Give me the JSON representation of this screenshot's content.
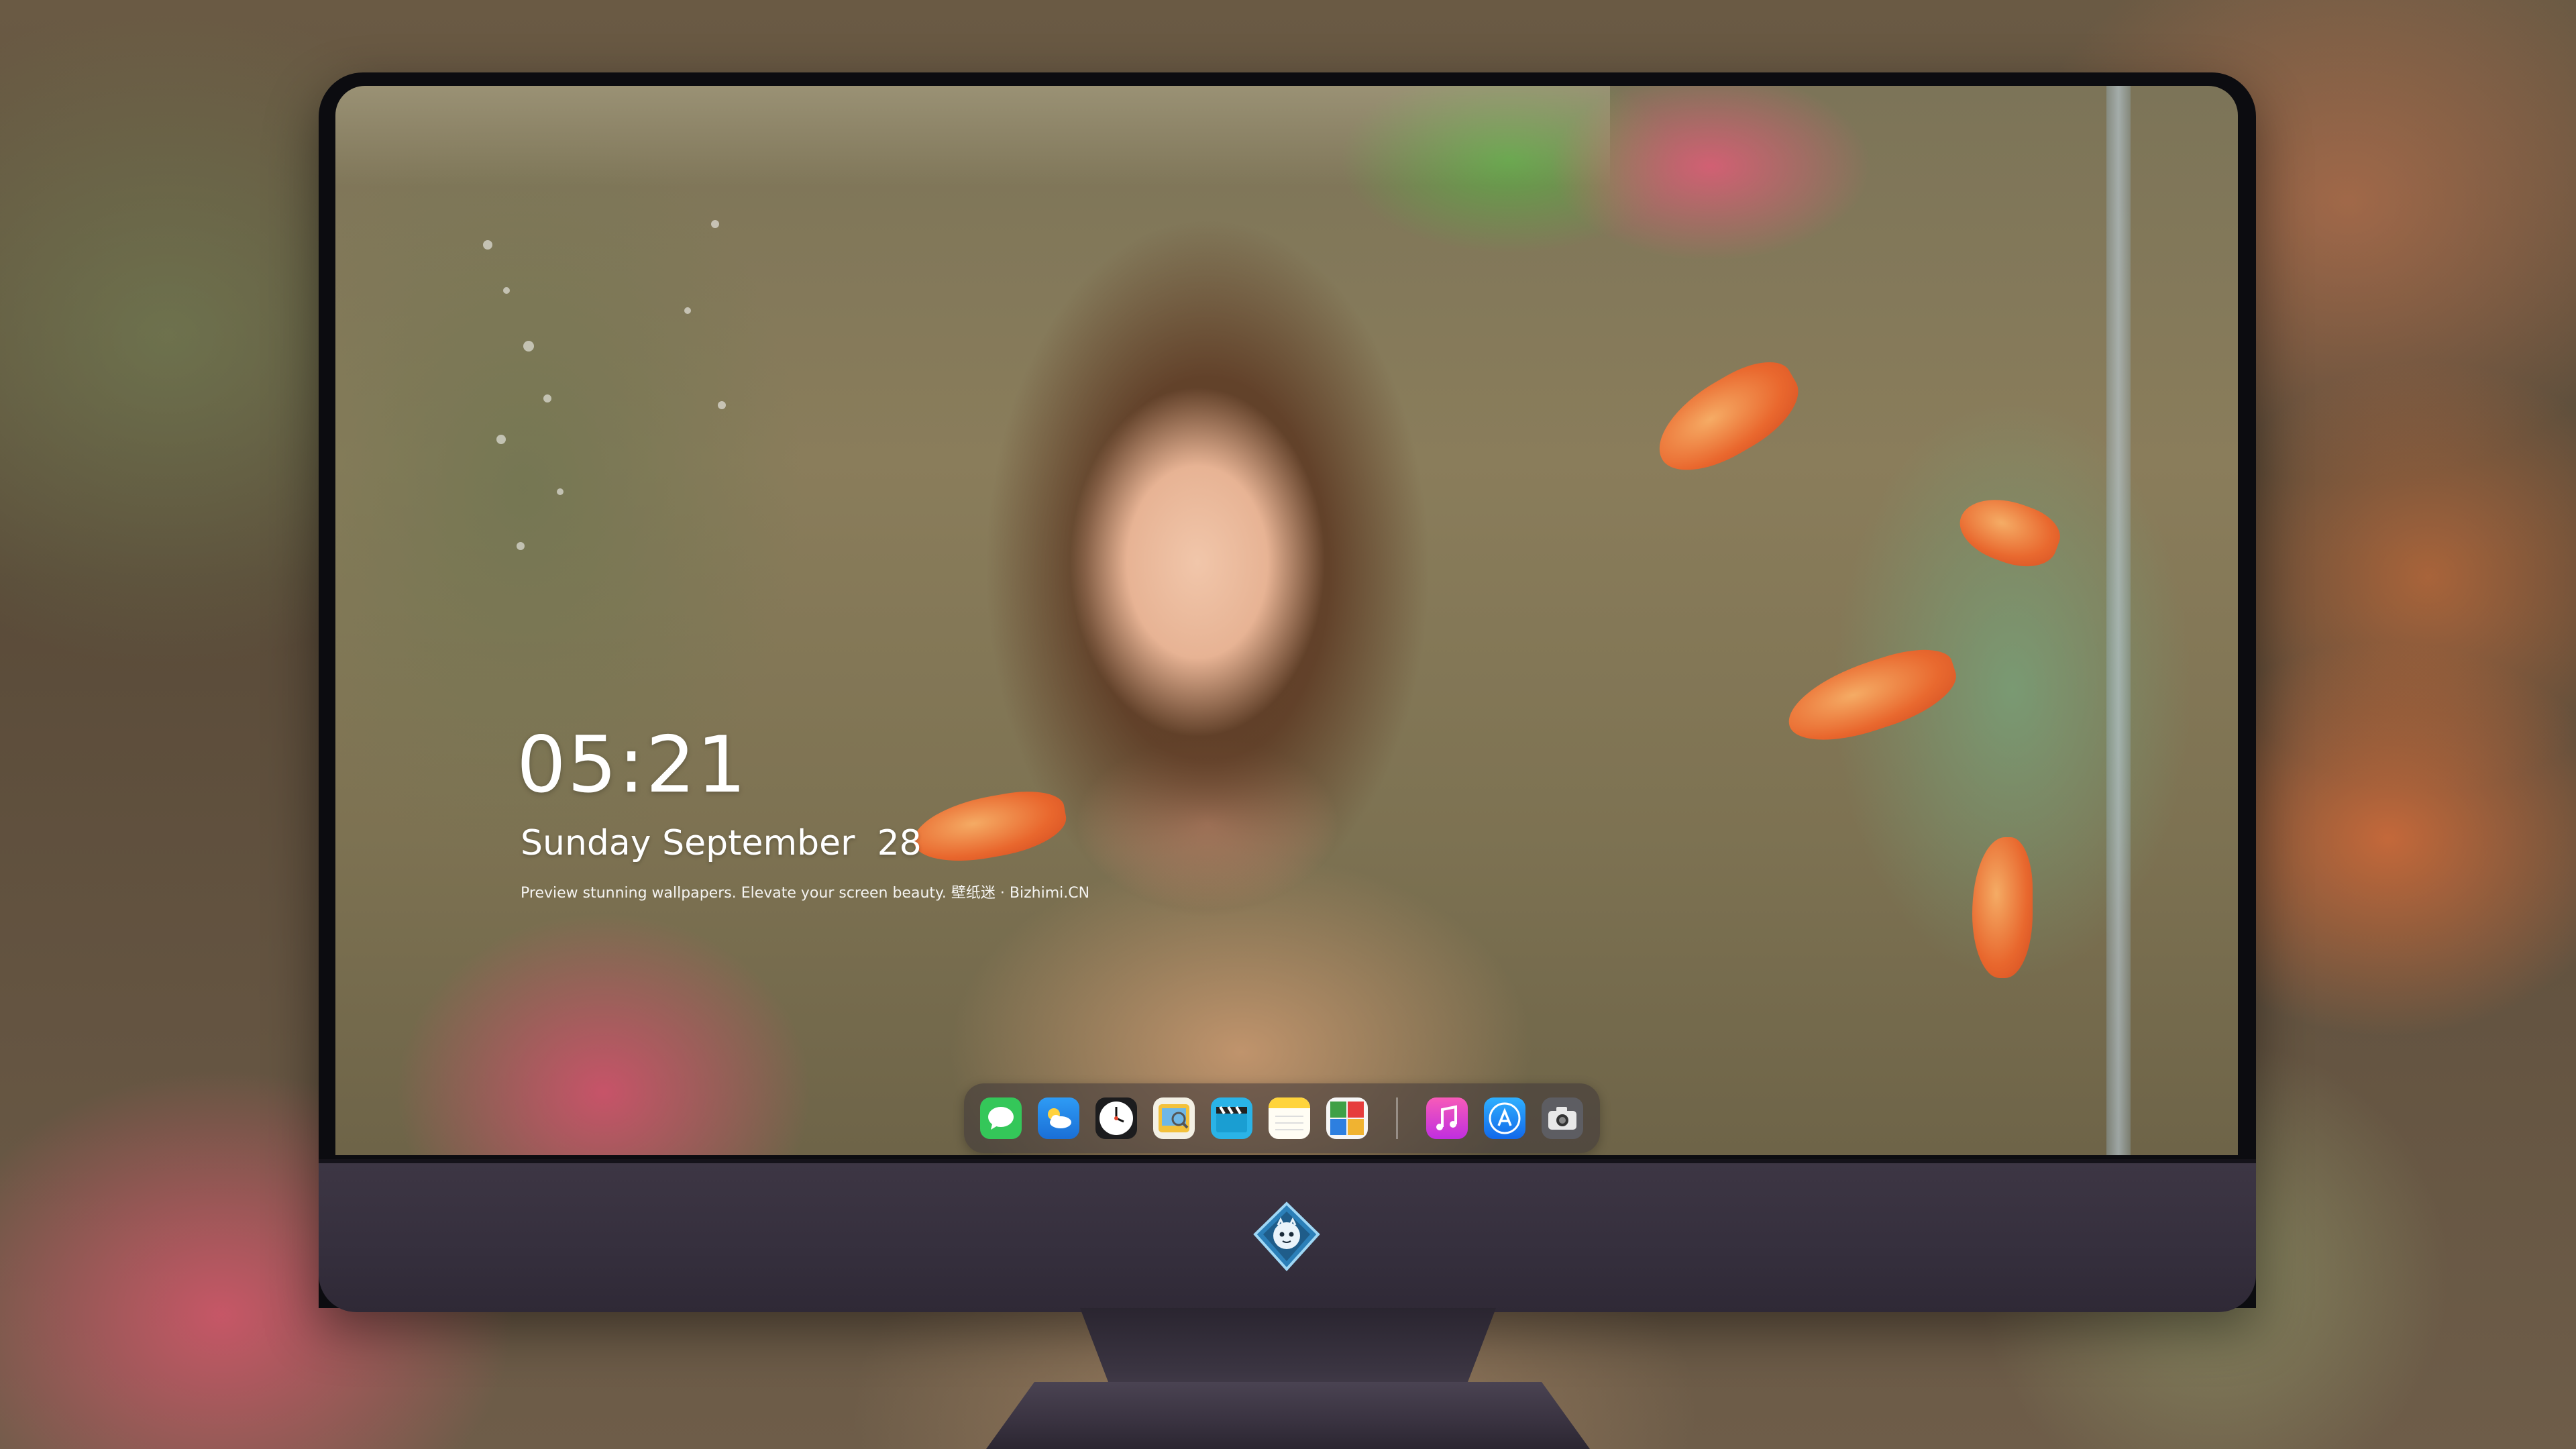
{
  "lock_screen": {
    "time": "05:21",
    "date": "Sunday September  28",
    "tagline": "Preview stunning wallpapers. Elevate your screen beauty. 壁纸迷 · Bizhimi.CN"
  },
  "dock": {
    "apps": [
      {
        "name": "Messages",
        "icon": "messages-icon",
        "color": "#34c759"
      },
      {
        "name": "Weather",
        "icon": "weather-icon",
        "color": "#1e8ef0"
      },
      {
        "name": "Clock",
        "icon": "clock-icon",
        "color": "#ffffff"
      },
      {
        "name": "Preview",
        "icon": "preview-icon",
        "color": "#f3c13a"
      },
      {
        "name": "Final Cut",
        "icon": "clapperboard-icon",
        "color": "#2ab3e7"
      },
      {
        "name": "Notes",
        "icon": "notes-icon",
        "color": "#ffd43b"
      },
      {
        "name": "Photo Booth",
        "icon": "photo-booth-icon",
        "color": "#3fa046"
      },
      {
        "name": "Music",
        "icon": "music-icon",
        "color": "#f04ba8"
      },
      {
        "name": "App Store",
        "icon": "app-store-icon",
        "color": "#1b8cf5"
      },
      {
        "name": "Screenshot",
        "icon": "camera-icon",
        "color": "#6b6b6b"
      }
    ]
  },
  "colors": {
    "monitor_bezel": "#0c0c10",
    "monitor_chin": "#3d3644",
    "goldfish": "#f2662a",
    "text": "#ffffff"
  }
}
